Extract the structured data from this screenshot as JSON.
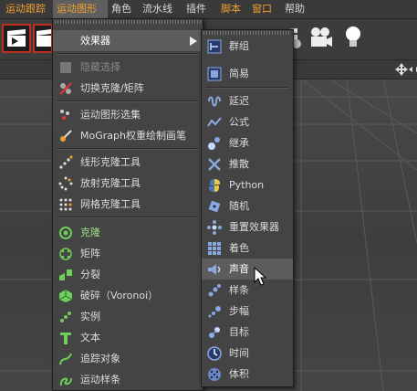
{
  "menubar": {
    "items": [
      "运动跟踪",
      "运动图形",
      "角色",
      "流水线",
      "插件",
      "脚本",
      "窗口",
      "帮助"
    ]
  },
  "main_menu": {
    "effectors_label": "效果器",
    "hide_selection": "隐藏选择",
    "toggle_clone": "切换克隆/矩阵",
    "mograph_selection": "运动图形选集",
    "mograph_weight_paint": "MoGraph权重绘制画笔",
    "linear_clone_tool": "线形克隆工具",
    "radial_clone_tool": "放射克隆工具",
    "grid_clone_tool": "网格克隆工具",
    "cloner": "克隆",
    "matrix": "矩阵",
    "fracture": "分裂",
    "voronoi_fracture": "破碎（Voronoi）",
    "instance": "实例",
    "text": "文本",
    "tracer": "追踪对象",
    "motion_spline": "运动样条"
  },
  "effectors_menu": {
    "items": [
      "群组",
      "简易",
      "延迟",
      "公式",
      "继承",
      "推散",
      "Python",
      "随机",
      "重置效果器",
      "着色",
      "声音",
      "样条",
      "步幅",
      "目标",
      "时间",
      "体积"
    ],
    "highlighted": "声音"
  },
  "colors": {
    "accent_orange": "#f0a030",
    "cloner_green": "#9fe08a",
    "menu_bg": "#444444",
    "highlight_bg": "#5c5c5c"
  }
}
